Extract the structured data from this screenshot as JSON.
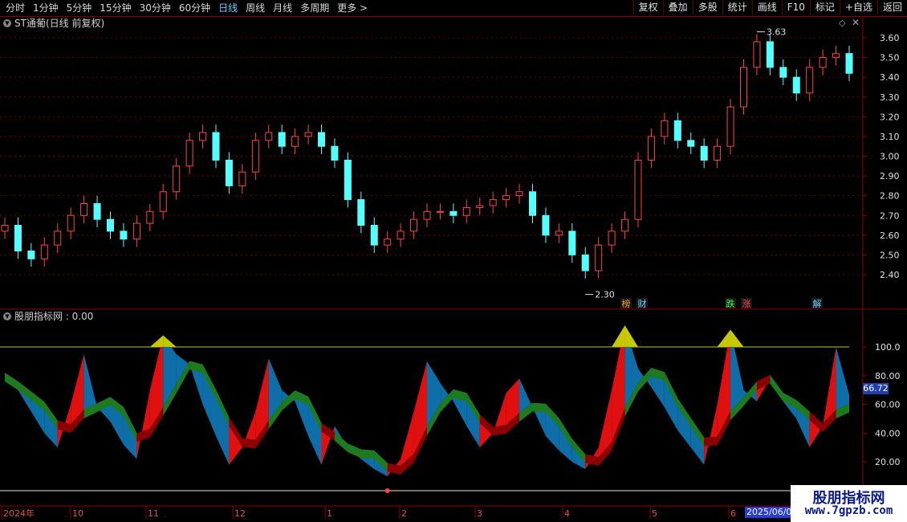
{
  "toolbar": {
    "periods": [
      "分时",
      "1分钟",
      "5分钟",
      "15分钟",
      "30分钟",
      "60分钟",
      "日线",
      "周线",
      "月线",
      "多周期",
      "更多 >"
    ],
    "active_index": 6,
    "actions": [
      "复权",
      "叠加",
      "多股",
      "统计",
      "画线",
      "F10",
      "标记",
      "+自选",
      "返回"
    ]
  },
  "main_pane": {
    "title": "ST通葡(日线 前复权)",
    "high_label": "3.63",
    "low_label": "2.30",
    "price_ticks": [
      "3.60",
      "3.50",
      "3.40",
      "3.30",
      "3.20",
      "3.10",
      "3.00",
      "2.90",
      "2.80",
      "2.70",
      "2.60",
      "2.50",
      "2.40"
    ],
    "event_tags": [
      "榜",
      "财",
      "跌",
      "涨",
      "解"
    ]
  },
  "indicator_pane": {
    "title": "股朋指标网 : 0.00",
    "ticks": [
      "100.0",
      "80.00",
      "60.00",
      "40.00",
      "20.00"
    ],
    "current_value": "66.72"
  },
  "x_axis": {
    "labels": [
      "2024年",
      "10",
      "11",
      "12",
      "1",
      "2",
      "3",
      "4",
      "5",
      "6"
    ],
    "cursor_date": "2025/06/0"
  },
  "watermark": {
    "name": "股朋指标网",
    "url": "www.7gpzb.com"
  },
  "colors": {
    "up": "#ff4444",
    "down": "#54ffff",
    "frame": "#8b0000",
    "accent": "#5fd3ff"
  },
  "chart_data": [
    {
      "type": "candlestick",
      "title": "ST通葡(日线 前复权)",
      "ylim": [
        2.3,
        3.65
      ],
      "x": [
        "2024年",
        "10",
        "11",
        "12",
        "1",
        "2",
        "3",
        "4",
        "5",
        "6"
      ],
      "close": [
        2.65,
        2.52,
        2.48,
        2.55,
        2.62,
        2.7,
        2.76,
        2.68,
        2.62,
        2.58,
        2.66,
        2.72,
        2.82,
        2.95,
        3.08,
        3.12,
        2.98,
        2.85,
        2.92,
        3.08,
        3.12,
        3.05,
        3.1,
        3.12,
        3.05,
        2.98,
        2.78,
        2.65,
        2.55,
        2.58,
        2.62,
        2.68,
        2.72,
        2.72,
        2.7,
        2.74,
        2.75,
        2.78,
        2.8,
        2.82,
        2.7,
        2.6,
        2.62,
        2.5,
        2.42,
        2.55,
        2.62,
        2.68,
        2.98,
        3.1,
        3.18,
        3.08,
        3.05,
        2.98,
        3.05,
        3.25,
        3.45,
        3.58,
        3.45,
        3.4,
        3.32,
        3.45,
        3.5,
        3.52,
        3.42
      ]
    },
    {
      "type": "area",
      "title": "股朋指标网",
      "ylim": [
        0,
        120
      ],
      "reference_lines": [
        100,
        0
      ],
      "current_value": 66.72,
      "series": [
        {
          "name": "",
          "values": [
            82,
            70,
            55,
            40,
            30,
            60,
            95,
            58,
            48,
            32,
            22,
            70,
            108,
            95,
            88,
            60,
            38,
            18,
            30,
            55,
            92,
            70,
            62,
            38,
            18,
            45,
            30,
            22,
            15,
            10,
            22,
            55,
            90,
            75,
            62,
            45,
            30,
            40,
            68,
            78,
            58,
            38,
            28,
            20,
            15,
            30,
            70,
            115,
            85,
            72,
            58,
            42,
            30,
            18,
            60,
            112,
            70,
            62,
            78,
            62,
            50,
            30,
            45,
            100,
            66.72
          ]
        }
      ]
    }
  ]
}
